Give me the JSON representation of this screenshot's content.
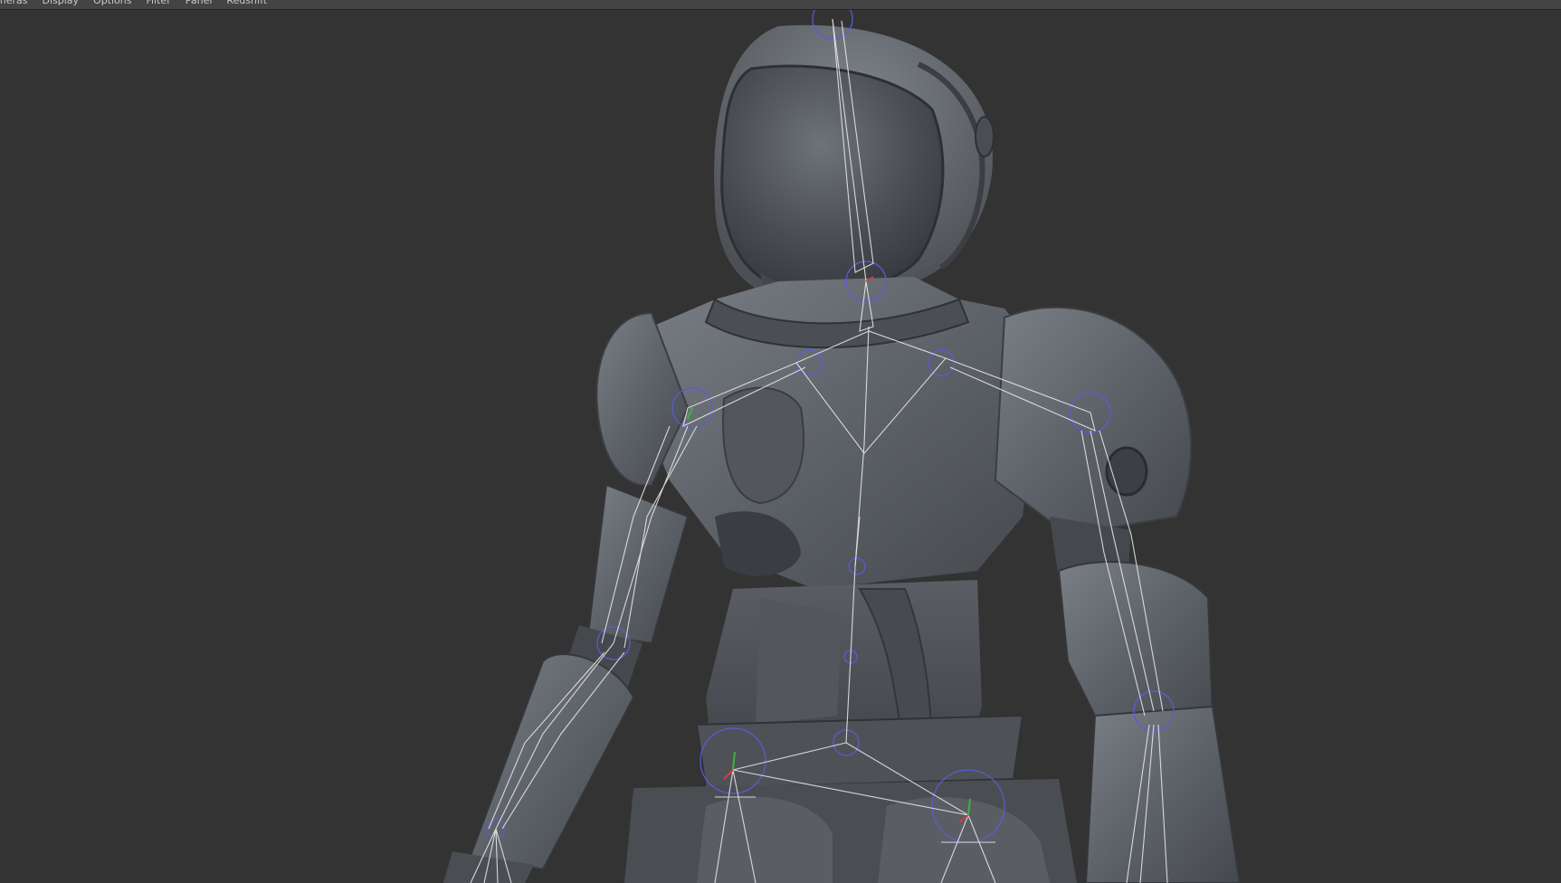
{
  "app": {
    "menu": [
      "meras",
      "Display",
      "Options",
      "Filter",
      "Panel",
      "Redshift"
    ]
  },
  "viewport": {
    "background_color": "#333333",
    "model_color": "#5f646b",
    "joint_color": "#5b5bd6",
    "bone_color": "#e6e6e6"
  }
}
